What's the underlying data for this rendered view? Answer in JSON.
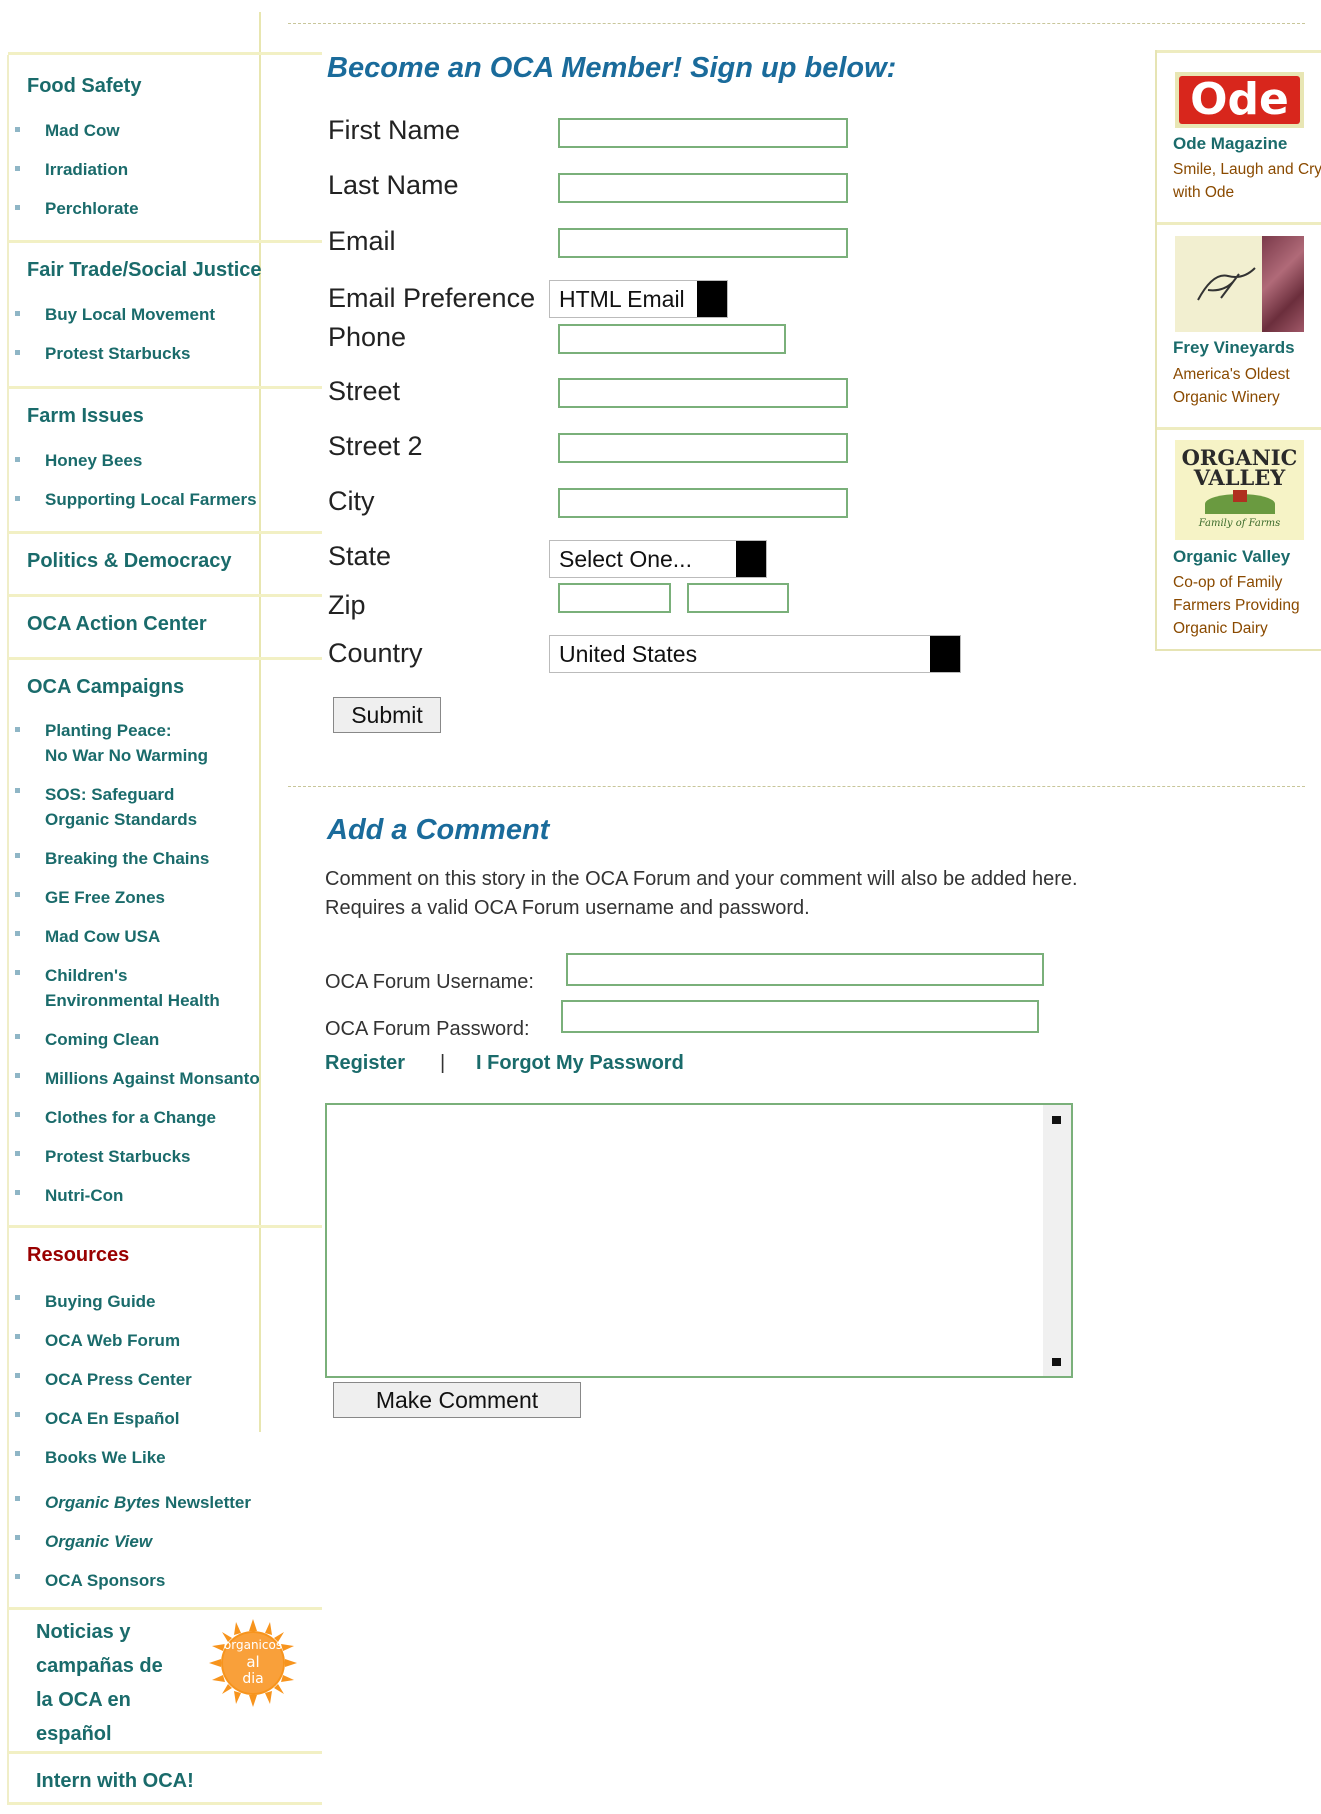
{
  "sidebar": {
    "food_safety": {
      "heading": "Food Safety",
      "items": [
        "Mad Cow",
        "Irradiation",
        "Perchlorate"
      ]
    },
    "fair_trade": {
      "heading": "Fair Trade/Social Justice",
      "items": [
        "Buy Local Movement",
        "Protest Starbucks"
      ]
    },
    "farm_issues": {
      "heading": "Farm Issues",
      "items": [
        "Honey Bees",
        "Supporting Local Farmers"
      ]
    },
    "politics": {
      "heading": "Politics & Democracy"
    },
    "action_center": {
      "heading": "OCA Action Center"
    },
    "campaigns": {
      "heading": "OCA Campaigns",
      "items": [
        "Planting Peace:",
        "No War No Warming",
        "SOS: Safeguard",
        "Organic Standards",
        "Breaking the Chains",
        "GE Free Zones",
        "Mad Cow USA",
        "Children's",
        "Environmental Health",
        "Coming Clean",
        "Millions Against Monsanto",
        "Clothes for a Change",
        "Protest Starbucks",
        "Nutri-Con"
      ]
    },
    "resources": {
      "heading": "Resources",
      "items": [
        "Buying Guide",
        "OCA Web Forum",
        "OCA Press Center",
        "OCA En Español",
        "Books We Like"
      ],
      "organic_bytes_italic": "Organic Bytes",
      "organic_bytes_rest": " Newsletter",
      "organic_view": "Organic View",
      "sponsors": "OCA Sponsors"
    },
    "espanol": {
      "lines": [
        "Noticias y",
        "campañas de",
        "la OCA en",
        "español"
      ],
      "logo_text_1": "organicos",
      "logo_text_2": "al",
      "logo_text_3": "dia"
    },
    "intern": "Intern with OCA!"
  },
  "signup": {
    "title": "Become an OCA Member! Sign up below:",
    "first_name": "First Name",
    "last_name": "Last Name",
    "email": "Email",
    "email_pref": "Email Preference",
    "email_pref_value": "HTML Email",
    "phone": "Phone",
    "street": "Street",
    "street2": "Street 2",
    "city": "City",
    "state": "State",
    "state_value": "Select One...",
    "zip": "Zip",
    "country": "Country",
    "country_value": "United States",
    "submit": "Submit"
  },
  "comment": {
    "title": "Add a Comment",
    "line1": "Comment on this story in the OCA Forum and your comment will also be added here.",
    "line2": "Requires a valid OCA Forum username and password.",
    "username_label": "OCA Forum Username:",
    "password_label": "OCA Forum Password:",
    "register": "Register",
    "separator": "|",
    "forgot": "I Forgot My Password",
    "submit": "Make Comment"
  },
  "ads": [
    {
      "logo_text": "Ode",
      "name": "Ode Magazine",
      "desc": "Smile, Laugh and Cry with Ode"
    },
    {
      "name": "Frey Vineyards",
      "desc": "America's Oldest Organic Winery"
    },
    {
      "logo_text_1": "ORGANIC",
      "logo_text_2": "VALLEY",
      "logo_text_3": "Family of Farms",
      "name": "Organic Valley",
      "desc": "Co-op of Family Farmers Providing Organic Dairy"
    }
  ],
  "colors": {
    "link": "#1a6b6b",
    "title": "#1a6b9b",
    "resources": "#990000",
    "field_border": "#7ab07a",
    "ad_desc": "#8a4a00"
  }
}
